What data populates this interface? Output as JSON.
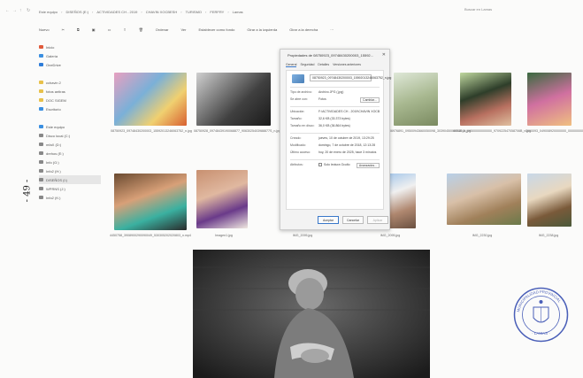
{
  "explorer": {
    "breadcrumb": [
      "Este equipo",
      "DISEÑOS (E:)",
      "ACTIVIDADES CH - 2019",
      "CHAVIN XOCBESH",
      "TURISMO",
      "FERFRY",
      "Lamas"
    ],
    "search_placeholder": "Buscar en Lamas",
    "toolbar": [
      "Nuevo",
      "Ordenar",
      "Ver",
      "Establecer como fondo",
      "Girar a la izquierda",
      "Girar a la derecha",
      "···"
    ],
    "sidebar": [
      {
        "label": "Inicio",
        "color": "#e05a3b"
      },
      {
        "label": "Galería",
        "color": "#3b8fe0"
      },
      {
        "label": "OneDrive",
        "color": "#2f7dd8"
      },
      {
        "label": "",
        "color": ""
      },
      {
        "label": "cchavin 2",
        "color": "#e8c14a"
      },
      {
        "label": "fotos antiras",
        "color": "#e8c14a"
      },
      {
        "label": "DOC SIGEM",
        "color": "#e8c14a"
      },
      {
        "label": "Escritorio",
        "color": "#3b8fe0"
      },
      {
        "label": "",
        "color": ""
      },
      {
        "label": "Este equipo",
        "color": "#3b8fe0"
      },
      {
        "label": "Disco local (C:)",
        "color": "#888888"
      },
      {
        "label": "mfaX (D:)",
        "color": "#888888"
      },
      {
        "label": "drehos (E:)",
        "color": "#888888"
      },
      {
        "label": "Info (G:)",
        "color": "#888888"
      },
      {
        "label": "Info2 (H:)",
        "color": "#888888"
      },
      {
        "label": "DISEÑOS (I:)",
        "color": "#888888"
      },
      {
        "label": "WPRNS (J:)",
        "color": "#888888"
      },
      {
        "label": "Info2 (K:)",
        "color": "#888888"
      }
    ],
    "files": [
      {
        "name": "08750923_09748430200003_15592013246063752_n.jpg"
      },
      {
        "name": "08750928_09748439190068877_9063025403988877S_n.jpg"
      },
      {
        "name": ""
      },
      {
        "name": "06976891_09500943660050098_3039045000654E_n.jpg"
      },
      {
        "name": "4003048_09500000000000_970922547058706B_n.jpg"
      },
      {
        "name": "0000093_049008920000000_0000000000000000_n.jpg"
      },
      {
        "name": "4450758_3908900290090049_530305202020803_n.mp4"
      },
      {
        "name": "Imagen1.jpg"
      },
      {
        "name": "IMG_2095.jpg"
      },
      {
        "name": "IMG_2095.jpg"
      },
      {
        "name": "IMG_2230.jpg"
      },
      {
        "name": "IMG_2238.jpg"
      }
    ]
  },
  "dialog": {
    "title": "Propiedades de 08750923_09748430200003_15592...",
    "tabs": [
      "General",
      "Seguridad",
      "Detalles",
      "Versiones anteriores"
    ],
    "filename": "08750923_09748430200003_15592013246063752_n.jpg",
    "rows": [
      {
        "k": "Tipo de archivo:",
        "v": "Archivo JPG (.jpg)"
      },
      {
        "k": "Se abre con:",
        "v": "Fotos"
      },
      {
        "k": "Ubicación:",
        "v": "F:\\ACTIVIDADES CH - 2019\\CHAVIN XOCBESH"
      },
      {
        "k": "Tamaño:",
        "v": "32,6 KB (33.373 bytes)"
      },
      {
        "k": "Tamaño en disco:",
        "v": "36,0 KB (36.864 bytes)"
      },
      {
        "k": "Creado:",
        "v": "jueves, 10 de octubre de 2019, 13:29:25"
      },
      {
        "k": "Modificado:",
        "v": "domingo, 7 de octubre de 2018, 12:13:28"
      },
      {
        "k": "Último acceso:",
        "v": "hoy, 20 de enero de 2025, hace 3 minutos"
      },
      {
        "k": "Atributos:",
        "v": "Solo lectura    Oculto"
      }
    ],
    "change_label": "Cambiar...",
    "advanced_label": "Avanzados...",
    "buttons": [
      "Aceptar",
      "Cancelar",
      "Aplicar"
    ]
  },
  "page_mark": "- 49 -",
  "stamp_text": "MUNICIPALIDAD PROVINCIAL DE LAMAS"
}
